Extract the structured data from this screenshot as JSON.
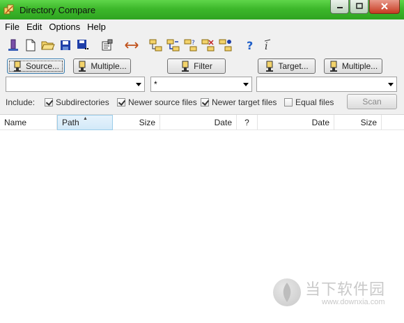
{
  "window": {
    "title": "Directory Compare"
  },
  "menu": {
    "items": [
      "File",
      "Edit",
      "Options",
      "Help"
    ]
  },
  "toolbar": {
    "icons": [
      "source-target-icon",
      "new-icon",
      "open-icon",
      "save-icon",
      "save-all-icon",
      "properties-icon",
      "swap-icon",
      "tree-compare-1-icon",
      "tree-compare-2-icon",
      "tree-compare-3-icon",
      "tree-compare-4-icon",
      "tree-compare-5-icon",
      "help-icon",
      "context-help-icon"
    ]
  },
  "buttons": {
    "source": "Source...",
    "source_multiple": "Multiple...",
    "filter": "Filter",
    "target": "Target...",
    "target_multiple": "Multiple...",
    "scan": "Scan"
  },
  "combos": {
    "source_value": "",
    "filter_value": "*",
    "target_value": ""
  },
  "include": {
    "label": "Include:",
    "options": [
      {
        "label": "Subdirectories",
        "checked": true
      },
      {
        "label": "Newer source files",
        "checked": true
      },
      {
        "label": "Newer target files",
        "checked": true
      },
      {
        "label": "Equal files",
        "checked": false
      }
    ]
  },
  "list": {
    "columns": [
      "Name",
      "Path",
      "Size",
      "Date",
      "?",
      "Date",
      "Size"
    ],
    "sorted_column": "Path",
    "rows": []
  },
  "watermark": {
    "text": "当下软件园",
    "url": "www.downxia.com"
  },
  "colors": {
    "titlebar": "#3db82b",
    "accent": "#3c7fb1",
    "sorted_header": "#d2e9f8"
  }
}
